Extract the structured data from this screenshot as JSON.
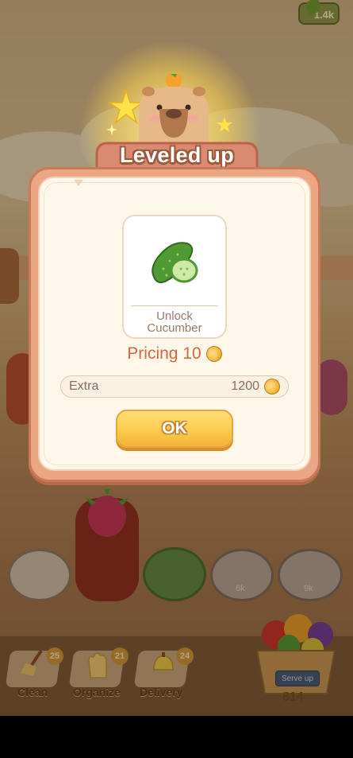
{
  "top": {
    "counter_value": "1.4k"
  },
  "popup": {
    "title": "Leveled up",
    "unlock_line1": "Unlock",
    "unlock_line2": "Cucumber",
    "pricing_label": "Pricing 10",
    "extra_label": "Extra",
    "extra_value": "1200",
    "ok_label": "OK"
  },
  "plates": {
    "labels": [
      "6k",
      "9k"
    ]
  },
  "bottom_bar": {
    "tools": [
      {
        "label": "Clean",
        "badge": "25"
      },
      {
        "label": "Organize",
        "badge": "21"
      },
      {
        "label": "Delivery",
        "badge": "24"
      }
    ],
    "serve_label": "Serve up",
    "serve_count": "814"
  },
  "colors": {
    "popup_frame": "#eba684",
    "popup_inner": "#fff8ea",
    "price_text": "#d4683c",
    "ok_button": "#fcc94a"
  },
  "icons": [
    "cucumber-icon",
    "coin-icon",
    "star-icon",
    "capybara-mascot"
  ]
}
